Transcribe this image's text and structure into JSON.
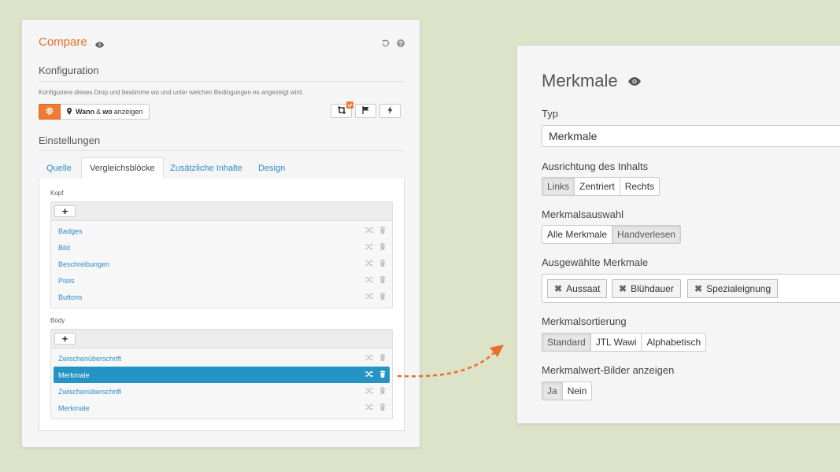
{
  "left": {
    "title": "Compare",
    "konfiguration_title": "Konfiguration",
    "konfiguration_desc": "Konfiguriere dieses Drop und bestimme wo und unter welchen Bedingungen es angezeigt wird.",
    "where_pre": "",
    "where_bold": "Wann",
    "where_amp": "&",
    "where_bold2": "wo",
    "where_post": "anzeigen",
    "einstellungen_title": "Einstellungen",
    "tabs": [
      "Quelle",
      "Vergleichsblöcke",
      "Zusätzliche Inhalte",
      "Design"
    ],
    "kopf_label": "Kopf",
    "kopf_items": [
      "Badges",
      "Bild",
      "Beschreibungen",
      "Preis",
      "Buttons"
    ],
    "body_label": "Body",
    "body_items": [
      "Zwischenüberschrift",
      "Merkmale",
      "Zwischenüberschrift",
      "Merkmale"
    ],
    "plus": "+"
  },
  "right": {
    "title": "Merkmale",
    "typ_label": "Typ",
    "typ_value": "Merkmale",
    "ausrichtung_label": "Ausrichtung des Inhalts",
    "ausrichtung_options": [
      "Links",
      "Zentriert",
      "Rechts"
    ],
    "auswahl_label": "Merkmalsauswahl",
    "auswahl_options": [
      "Alle Merkmale",
      "Handverlesen"
    ],
    "ausgewaehlt_label": "Ausgewählte Merkmale",
    "tags": [
      "Aussaat",
      "Blühdauer",
      "Spezialeignung"
    ],
    "tag_remove": "✖",
    "sortierung_label": "Merkmalsortierung",
    "sortierung_options": [
      "Standard",
      "JTL Wawi",
      "Alphabetisch"
    ],
    "bilder_label": "Merkmalwert-Bilder anzeigen",
    "bilder_options": [
      "Ja",
      "Nein"
    ]
  },
  "colors": {
    "accent": "#ee7a33",
    "link": "#2b8dc9",
    "selected_row": "#2594c4",
    "background": "#dde3c8"
  }
}
